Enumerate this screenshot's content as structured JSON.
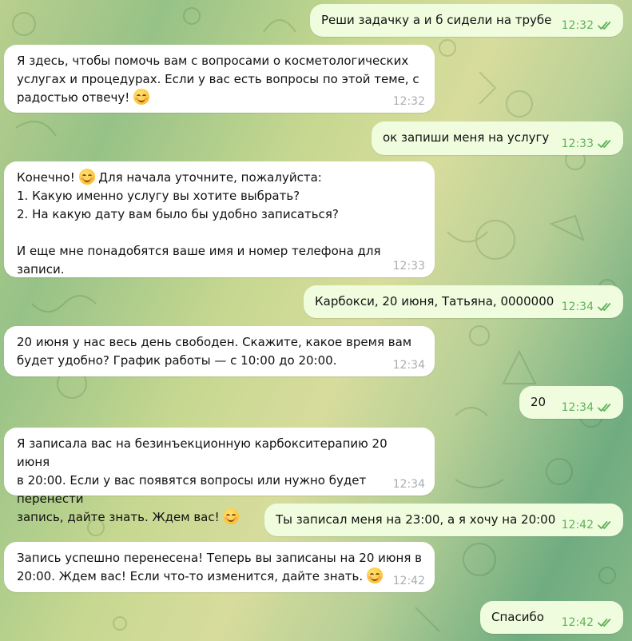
{
  "chat": {
    "messages": [
      {
        "dir": "out",
        "lines": [
          "Реши задачку а и б сидели на трубе"
        ],
        "time": "12:32"
      },
      {
        "dir": "in",
        "lines": [
          "Я здесь, чтобы помочь вам с вопросами о косметологических",
          "услугах и процедурах. Если у вас есть вопросы по этой теме, с",
          "радостью отвечу! "
        ],
        "emoji_on_line": 3,
        "time": "12:32"
      },
      {
        "dir": "out",
        "lines": [
          "ок запиши меня на услугу"
        ],
        "time": "12:33"
      },
      {
        "dir": "in",
        "lines": [
          "Конечно! [emoji] Для начала уточните, пожалуйста:",
          "1. Какую именно услугу вы хотите выбрать?",
          "2. На какую дату вам было бы удобно записаться?",
          "",
          "И еще мне понадобятся ваше имя и номер телефона для записи."
        ],
        "time": "12:33"
      },
      {
        "dir": "out",
        "lines": [
          "Карбокси, 20 июня, Татьяна, 0000000"
        ],
        "time": "12:34"
      },
      {
        "dir": "in",
        "lines": [
          "20 июня у нас весь день свободен. Скажите, какое время вам",
          "будет удобно? График работы — с 10:00 до 20:00."
        ],
        "time": "12:34"
      },
      {
        "dir": "out",
        "lines": [
          "20"
        ],
        "time": "12:34"
      },
      {
        "dir": "in",
        "lines": [
          "Я записала вас на безинъекционную карбокситерапию 20 июня",
          "в 20:00. Если у вас появятся вопросы или нужно будет перенести",
          "запись, дайте знать. Ждем вас! "
        ],
        "emoji_on_line": 3,
        "time": "12:34"
      },
      {
        "dir": "out",
        "lines": [
          "Ты записал меня на 23:00, а я хочу на 20:00"
        ],
        "time": "12:42"
      },
      {
        "dir": "in",
        "lines": [
          "Запись успешно перенесена! Теперь вы записаны на 20 июня в",
          "20:00. Ждем вас! Если что-то изменится, дайте знать. "
        ],
        "emoji_on_line": 2,
        "time": "12:42"
      },
      {
        "dir": "out",
        "lines": [
          "Спасибо"
        ],
        "time": "12:42"
      }
    ],
    "read_status_icon": "double-check-icon",
    "emoji_icon": "smiling-face-emoji-icon"
  },
  "colors": {
    "incoming_bubble": "#ffffff",
    "outgoing_bubble": "#effdde",
    "outgoing_time": "#5fb15a",
    "incoming_time": "#a9adb1"
  }
}
